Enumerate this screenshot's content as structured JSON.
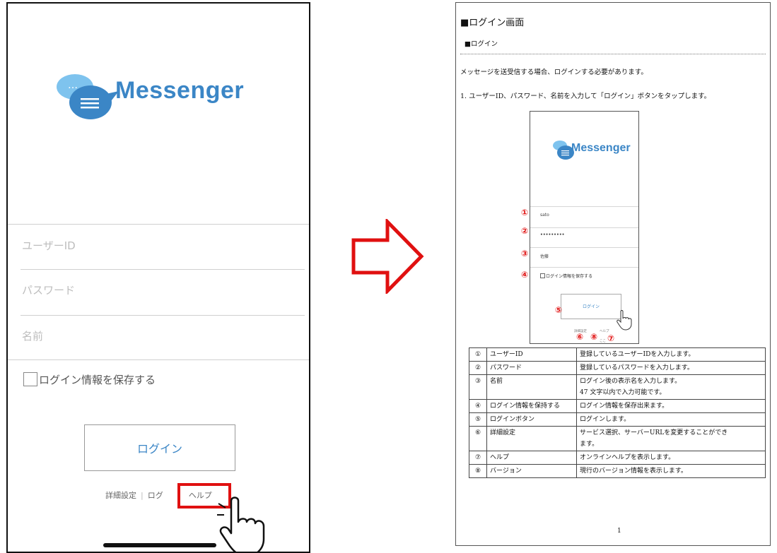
{
  "phone": {
    "app_name": "Messenger",
    "user_id_placeholder": "ユーザーID",
    "password_placeholder": "パスワード",
    "name_placeholder": "名前",
    "save_login_label": "ログイン情報を保存する",
    "login_button": "ログイン",
    "links": [
      "詳細設定",
      "ログ",
      "ヘルプ"
    ]
  },
  "doc": {
    "heading": "■ログイン画面",
    "subheading": "■ログイン",
    "intro": "メッセージを送受信する場合、ログインする必要があります。",
    "step1": "1. ユーザーID、パスワード、名前を入力して「ログイン」ボタンをタップします。",
    "page_number": "1",
    "mini": {
      "app_name": "Messenger",
      "user_value": "sato",
      "password_value": "•••••••••",
      "name_value": "佐藤",
      "save_login_label": "ログイン情報を保存する",
      "login_button": "ログイン",
      "links": "詳細設定　　　　ヘルプ",
      "version": "ここ"
    },
    "callouts": [
      "①",
      "②",
      "③",
      "④",
      "⑤",
      "⑥",
      "⑧",
      "⑦"
    ],
    "table": [
      {
        "num": "①",
        "item": "ユーザーID",
        "desc": "登録しているユーザーIDを入力します。",
        "desc2": ""
      },
      {
        "num": "②",
        "item": "パスワード",
        "desc": "登録しているパスワードを入力します。",
        "desc2": ""
      },
      {
        "num": "③",
        "item": "名前",
        "desc": "ログイン後の表示名を入力します。",
        "desc2": "47 文字以内で入力可能です。"
      },
      {
        "num": "④",
        "item": "ログイン情報を保持する",
        "desc": "ログイン情報を保存出来ます。",
        "desc2": ""
      },
      {
        "num": "⑤",
        "item": "ログインボタン",
        "desc": "ログインします。",
        "desc2": ""
      },
      {
        "num": "⑥",
        "item": "詳細設定",
        "desc": "サービス選択、サーバーURLを変更することができ",
        "desc2": "ます。"
      },
      {
        "num": "⑦",
        "item": "ヘルプ",
        "desc": "オンラインヘルプを表示します。",
        "desc2": ""
      },
      {
        "num": "⑧",
        "item": "バージョン",
        "desc": "現行のバージョン情報を表示します。",
        "desc2": ""
      }
    ]
  },
  "colors": {
    "brand": "#3b86c6",
    "highlight": "#e01010"
  }
}
